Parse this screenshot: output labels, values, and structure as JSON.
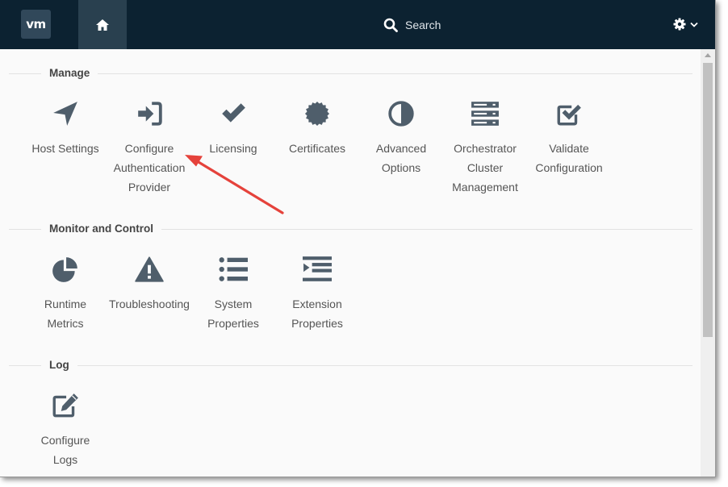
{
  "header": {
    "logo": "vm",
    "search_label": "Search",
    "icons": {
      "home": "home-icon",
      "search": "search-icon",
      "settings": "gear-icon",
      "menu": "chevron-down-icon"
    }
  },
  "sections": [
    {
      "title": "Manage",
      "items": [
        {
          "label": "Host Settings",
          "icon": "location-arrow-icon"
        },
        {
          "label": "Configure\nAuthentication\nProvider",
          "icon": "sign-in-icon"
        },
        {
          "label": "Licensing",
          "icon": "checkmark-icon"
        },
        {
          "label": "Certificates",
          "icon": "certificate-icon"
        },
        {
          "label": "Advanced\nOptions",
          "icon": "half-circle-icon"
        },
        {
          "label": "Orchestrator\nCluster\nManagement",
          "icon": "server-stack-icon"
        },
        {
          "label": "Validate\nConfiguration",
          "icon": "check-square-icon"
        }
      ]
    },
    {
      "title": "Monitor and Control",
      "items": [
        {
          "label": "Runtime\nMetrics",
          "icon": "pie-chart-icon"
        },
        {
          "label": "Troubleshooting",
          "icon": "warning-icon"
        },
        {
          "label": "System\nProperties",
          "icon": "list-icon"
        },
        {
          "label": "Extension\nProperties",
          "icon": "indent-list-icon"
        }
      ]
    },
    {
      "title": "Log",
      "items": [
        {
          "label": "Configure\nLogs",
          "icon": "edit-icon"
        }
      ]
    }
  ],
  "colors": {
    "topbar": "#0c2231",
    "home_active": "#29404f",
    "icon": "#4f5e6b",
    "text": "#555555",
    "annotation_arrow": "#e5423b"
  }
}
